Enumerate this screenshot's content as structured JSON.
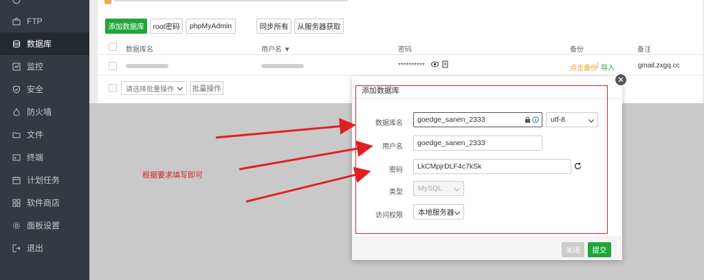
{
  "sidebar": {
    "items": [
      {
        "label": "FTP",
        "icon": "ftp-icon"
      },
      {
        "label": "数据库",
        "icon": "database-icon",
        "active": true
      },
      {
        "label": "监控",
        "icon": "monitor-icon"
      },
      {
        "label": "安全",
        "icon": "shield-icon"
      },
      {
        "label": "防火墙",
        "icon": "firewall-icon"
      },
      {
        "label": "文件",
        "icon": "folder-icon"
      },
      {
        "label": "终端",
        "icon": "terminal-icon"
      },
      {
        "label": "计划任务",
        "icon": "calendar-icon"
      },
      {
        "label": "软件商店",
        "icon": "grid-icon"
      },
      {
        "label": "面板设置",
        "icon": "gear-icon"
      },
      {
        "label": "退出",
        "icon": "logout-icon"
      }
    ]
  },
  "toolbar": {
    "add_db": "添加数据库",
    "root_pwd": "root密码",
    "phpmyadmin": "phpMyAdmin",
    "sync_all": "同步所有",
    "from_server": "从服务器获取"
  },
  "table": {
    "headers": {
      "name": "数据库名",
      "user": "用户名 ▼",
      "password": "密码",
      "backup": "备份",
      "note": "备注"
    },
    "row": {
      "password_mask": "**********",
      "backup_link": "点击备份",
      "sep": "|",
      "import_link": "导入",
      "note": "gmail.zxgq.cc"
    },
    "batch_select": "请选择批量操作",
    "batch_btn": "批量操作"
  },
  "modal": {
    "title": "添加数据库",
    "db_name_label": "数据库名",
    "db_name_value": "goedge_sanen_2333",
    "charset": "utf-8",
    "user_label": "用户名",
    "user_value": "goedge_sanen_2333",
    "pwd_label": "密码",
    "pwd_value": "LkCMpjrDLF4c7kSk",
    "type_label": "类型",
    "type_value": "MySQL",
    "access_label": "访问权限",
    "access_value": "本地服务器",
    "close_btn": "关闭",
    "submit_btn": "提交"
  },
  "annotation": {
    "text": "根据要求填写即可"
  },
  "colors": {
    "sidebar_bg": "#333a41",
    "accent_green": "#20a53a",
    "annotation_red": "#e02020",
    "backup_orange": "#f0a020"
  }
}
